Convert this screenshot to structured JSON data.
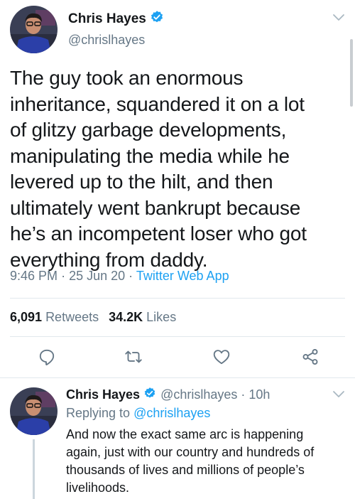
{
  "colors": {
    "text": "#14171a",
    "secondary": "#657786",
    "accent": "#1da1f2",
    "divider": "#e1e8ed"
  },
  "main_tweet": {
    "author": {
      "display_name": "Chris Hayes",
      "handle": "@chrislhayes",
      "verified": true
    },
    "text": "The guy took an enormous\ninheritance, squandered it on a lot\nof glitzy garbage developments,\nmanipulating the media while he\nlevered up to the hilt, and then\nultimately went bankrupt because\nhe’s an incompetent loser who got\neverything from daddy.",
    "time": "9:46 PM",
    "date": "25 Jun 20",
    "separator": "·",
    "source": "Twitter Web App",
    "retweets_count": "6,091",
    "retweets_label": "Retweets",
    "likes_count": "34.2K",
    "likes_label": "Likes",
    "actions": [
      "reply-icon",
      "retweet-icon",
      "like-icon",
      "share-icon"
    ]
  },
  "reply_tweet": {
    "author": {
      "display_name": "Chris Hayes",
      "handle": "@chrislhayes",
      "verified": true
    },
    "time_ago": "10h",
    "separator": "·",
    "replying_prefix": "Replying to",
    "replying_to": "@chrislhayes",
    "text": "And now the exact same arc is happening\nagain, just with our country and hundreds of\nthousands of lives and millions of people’s\nlivelihoods."
  }
}
